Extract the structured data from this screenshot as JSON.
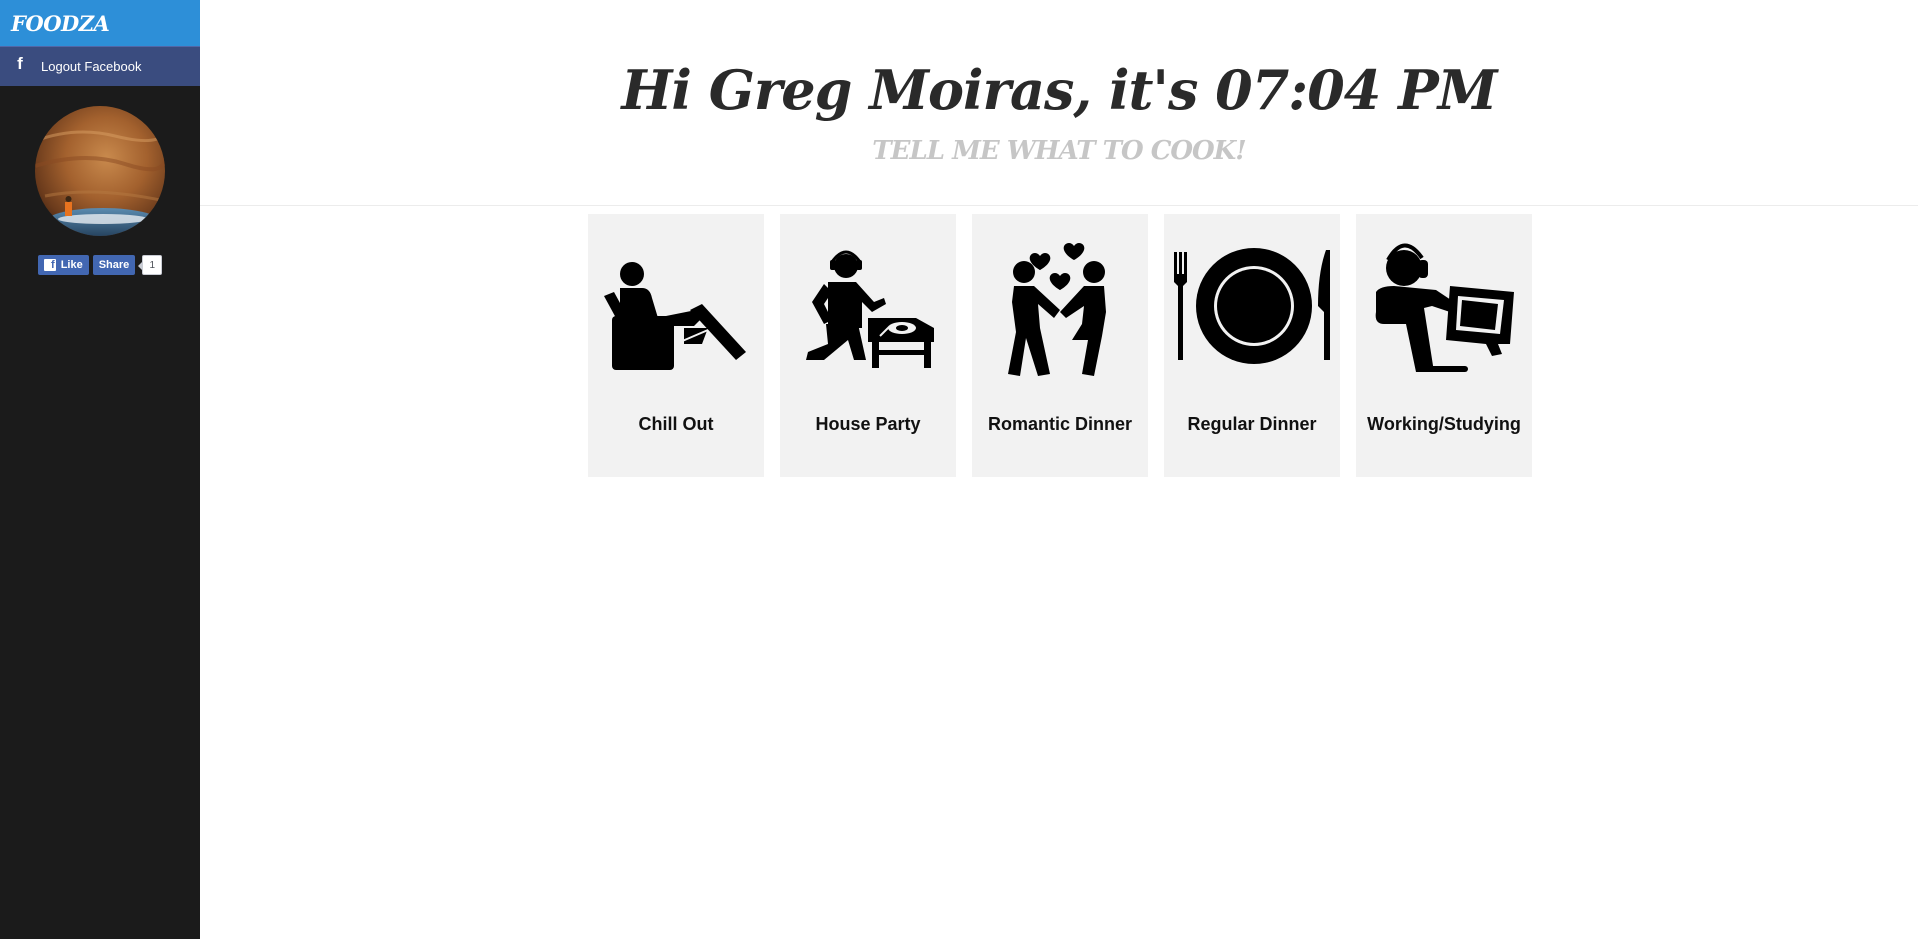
{
  "app": {
    "brand": "FOODZA"
  },
  "sidebar": {
    "logout_label": "Logout Facebook",
    "like_label": "Like",
    "share_label": "Share",
    "share_count": "1"
  },
  "header": {
    "greeting": "Hi Greg Moiras, it's 07:04 PM",
    "subtitle": "TELL ME WHAT TO COOK!"
  },
  "moods": [
    {
      "label": "Chill Out",
      "icon": "armchair-relaxing-icon"
    },
    {
      "label": "House Party",
      "icon": "dj-turntable-icon"
    },
    {
      "label": "Romantic Dinner",
      "icon": "couple-hearts-icon"
    },
    {
      "label": "Regular Dinner",
      "icon": "plate-cutlery-icon"
    },
    {
      "label": "Working/Studying",
      "icon": "computer-headset-icon"
    }
  ],
  "colors": {
    "brand_bar": "#2d8fd8",
    "facebook": "#3a4c7f",
    "sidebar_bg": "#1b1b1b",
    "card_bg": "#f2f2f2",
    "subtitle": "#c6c6c6"
  }
}
